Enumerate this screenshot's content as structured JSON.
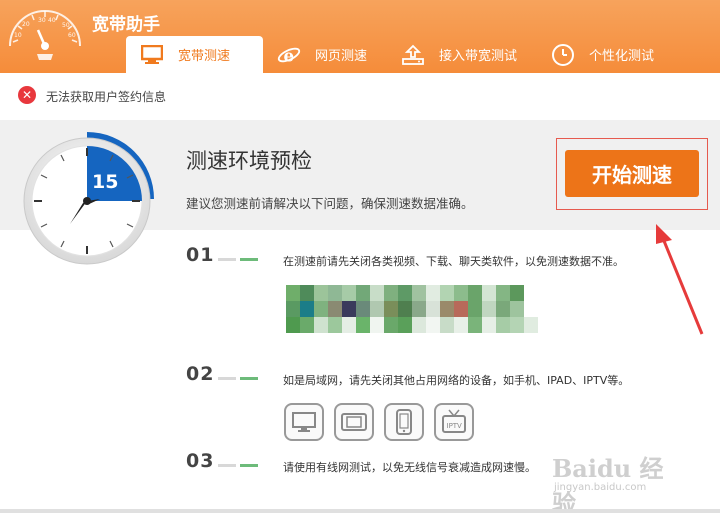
{
  "app": {
    "title": "宽带助手"
  },
  "logo": {
    "gauge_labels": [
      "10",
      "20",
      "30",
      "40",
      "50",
      "60"
    ]
  },
  "tabs": [
    {
      "label": "宽带测速",
      "icon": "monitor-icon",
      "active": true
    },
    {
      "label": "网页测速",
      "icon": "ie-browser-icon",
      "active": false
    },
    {
      "label": "接入带宽测试",
      "icon": "upload-box-icon",
      "active": false
    },
    {
      "label": "个性化测试",
      "icon": "clock-icon",
      "active": false
    }
  ],
  "error": {
    "message": "无法获取用户签约信息"
  },
  "precheck": {
    "countdown": "15",
    "title": "测速环境预检",
    "subtitle": "建议您测速前请解决以下问题，确保测速数据准确。",
    "start_label": "开始测速"
  },
  "steps": [
    {
      "num": "01",
      "text": "在测速前请先关闭各类视频、下载、聊天类软件，以免测速数据不准。"
    },
    {
      "num": "02",
      "text": "如是局域网，请先关闭其他占用网络的设备，如手机、IPAD、IPTV等。"
    },
    {
      "num": "03",
      "text": "请使用有线网测试，以免无线信号衰减造成网速慢。"
    }
  ],
  "devices": [
    {
      "name": "desktop-monitor-icon"
    },
    {
      "name": "tablet-landscape-icon"
    },
    {
      "name": "phone-icon"
    },
    {
      "name": "iptv-icon",
      "label": "IPTV"
    }
  ],
  "colors": {
    "brand_orange": "#f58c3a",
    "button_orange": "#ed7418",
    "error_red": "#e8383d",
    "clock_blue": "#1565c0",
    "dash_green": "#6dbb7a"
  },
  "watermark": {
    "text": "Baidu 经验",
    "url": "jingyan.baidu.com"
  }
}
